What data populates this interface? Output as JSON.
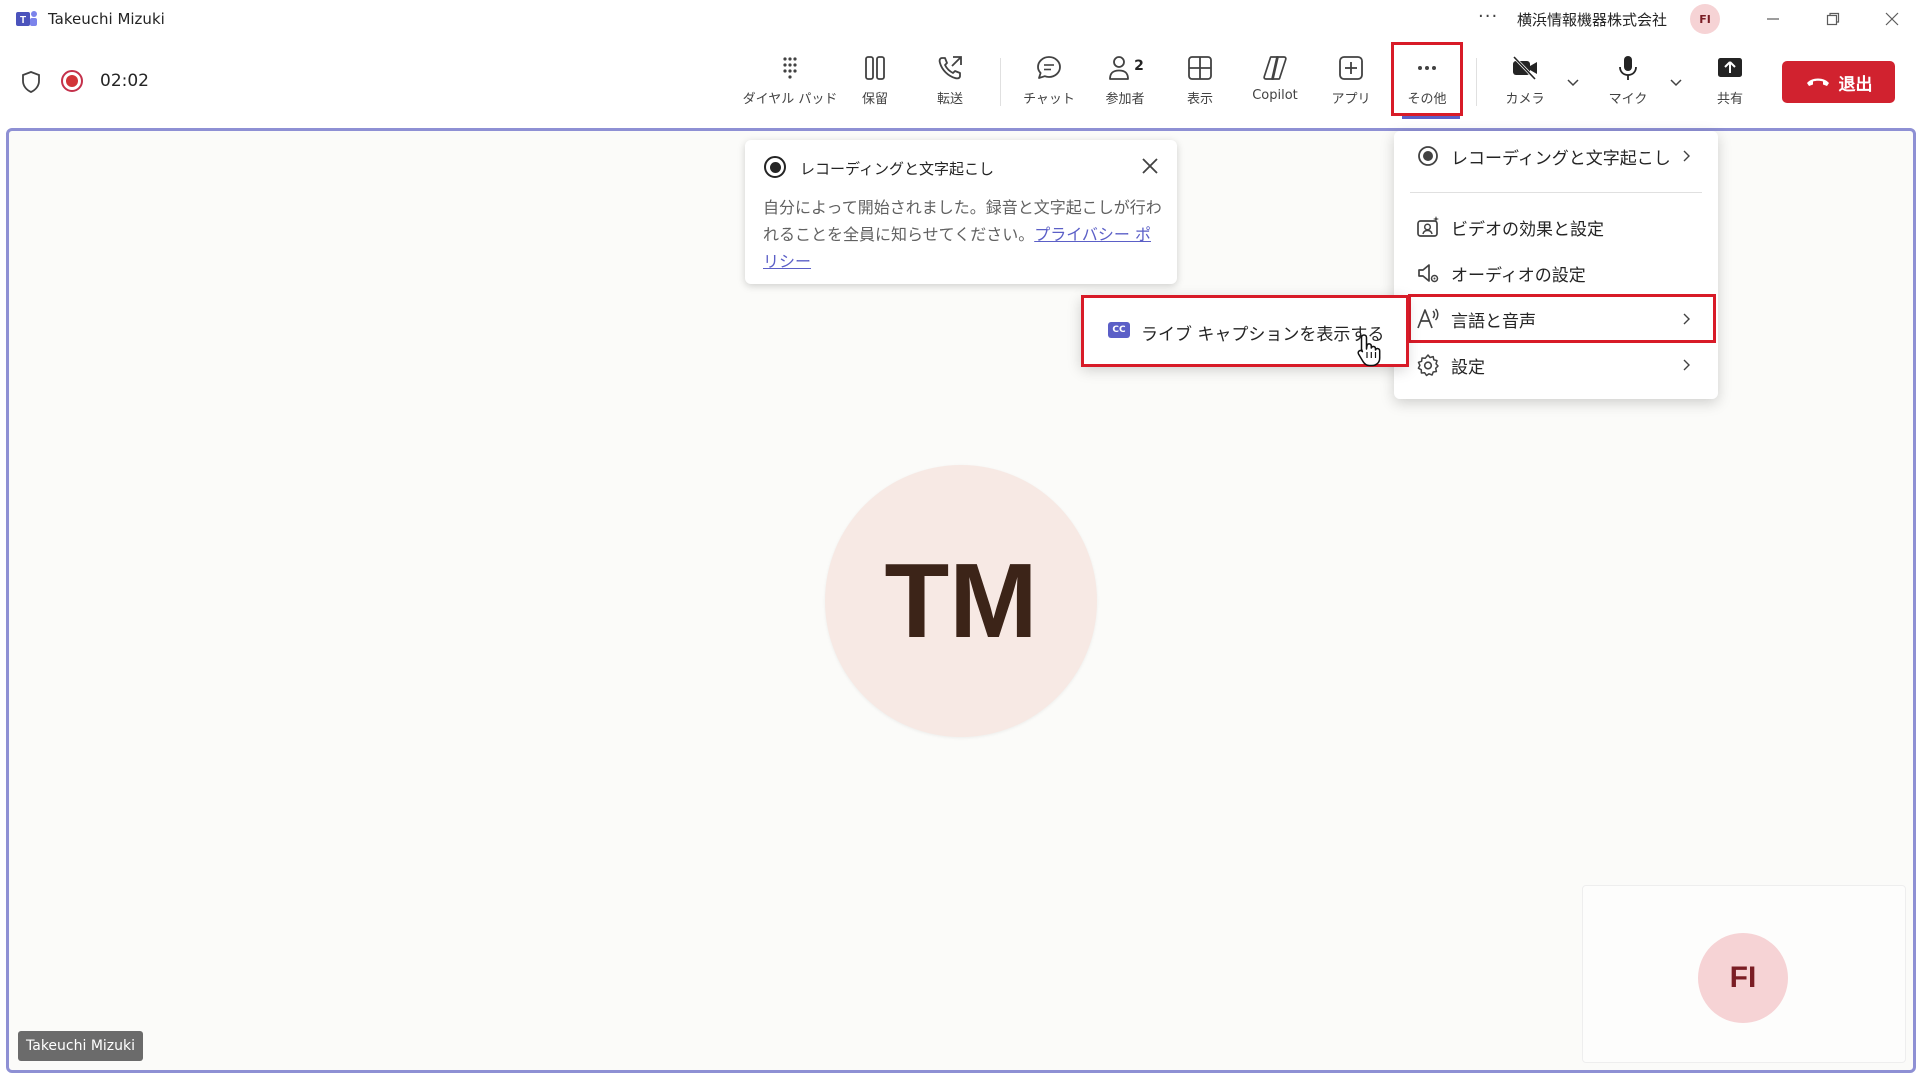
{
  "window": {
    "title": "Takeuchi Mizuki",
    "more": "···",
    "org": "横浜情報機器株式会社",
    "user_initials": "FI"
  },
  "call": {
    "timer": "02:02"
  },
  "toolbar": {
    "dialpad": "ダイヤル パッド",
    "hold": "保留",
    "transfer": "転送",
    "chat": "チャット",
    "participants": "参加者",
    "participants_count": "2",
    "view": "表示",
    "copilot": "Copilot",
    "apps": "アプリ",
    "more": "その他",
    "camera": "カメラ",
    "mic": "マイク",
    "share": "共有",
    "leave": "退出"
  },
  "notice": {
    "title": "レコーディングと文字起こし",
    "body": "自分によって開始されました。録音と文字起こしが行われることを全員に知らせてください。",
    "link": "プライバシー ポリシー"
  },
  "menu": {
    "items": [
      {
        "label": "レコーディングと文字起こし",
        "icon": "record-icon"
      },
      {
        "label": "ビデオの効果と設定",
        "icon": "video-effects-icon"
      },
      {
        "label": "オーディオの設定",
        "icon": "audio-settings-icon"
      },
      {
        "label": "言語と音声",
        "icon": "language-speech-icon"
      },
      {
        "label": "設定",
        "icon": "gear-icon"
      }
    ]
  },
  "submenu": {
    "cc": "CC",
    "label": "ライブ キャプションを表示する"
  },
  "stage": {
    "main_initials": "TM",
    "main_name": "Takeuchi Mizuki",
    "self_initials": "FI"
  },
  "colors": {
    "accent": "#5b5fc7",
    "leave": "#d1222f",
    "highlight": "#d81b28"
  }
}
